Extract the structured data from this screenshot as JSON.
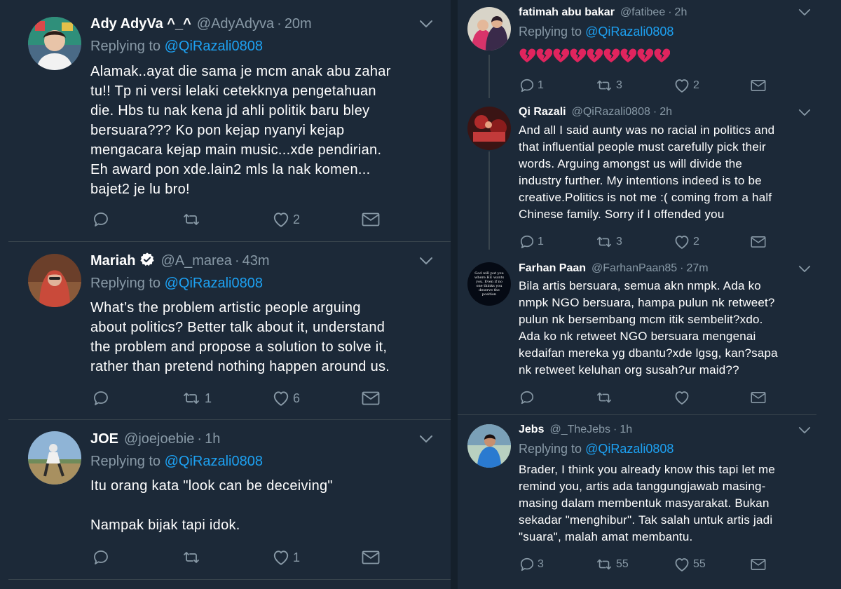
{
  "left": {
    "tweets": [
      {
        "name": "Ady AdyVa ^_^",
        "handle": "@AdyAdyva",
        "time": "20m",
        "replying_label": "Replying to",
        "mention": "@QiRazali0808",
        "body": "Alamak..ayat die sama je mcm anak abu zahar\ntu!! Tp ni versi lelaki cetekknya pengetahuan\ndie. Hbs tu nak kena jd ahli politik baru bley\nbersuara??? Ko pon kejap nyanyi kejap\nmengacara kejap main music...xde pendirian.\nEh award pon xde.lain2 mls la nak komen...\nbajet2 je lu bro!",
        "replies": "",
        "retweets": "",
        "likes": "2"
      },
      {
        "name": "Mariah",
        "handle": "@A_marea",
        "time": "43m",
        "replying_label": "Replying to",
        "mention": "@QiRazali0808",
        "body": "What’s the problem artistic people arguing\nabout politics? Better talk about it, understand\nthe problem and propose a solution to solve it,\nrather than pretend nothing happen around us.",
        "replies": "",
        "retweets": "1",
        "likes": "6"
      },
      {
        "name": "JOE",
        "handle": "@joejoebie",
        "time": "1h",
        "replying_label": "Replying to",
        "mention": "@QiRazali0808",
        "body": "Itu orang kata \"look can be deceiving\"\n\nNampak bijak tapi idok.",
        "replies": "",
        "retweets": "",
        "likes": "1"
      }
    ]
  },
  "right": {
    "tweets": [
      {
        "name": "fatimah abu bakar",
        "handle": "@fatibee",
        "time": "2h",
        "replying_label": "Replying to",
        "mention": "@QiRazali0808",
        "body": "",
        "emoji": "💔💔💔💔💔💔💔💔💔",
        "replies": "1",
        "retweets": "3",
        "likes": "2"
      },
      {
        "name": "Qi Razali",
        "handle": "@QiRazali0808",
        "time": "2h",
        "body": "And all I said aunty was no racial in politics and\nthat influential people must carefully pick their\nwords. Arguing amongst us will divide the\nindustry further. My intentions indeed is to be\ncreative.Politics is not me :( coming from a half\nChinese family. Sorry if I offended you",
        "replies": "1",
        "retweets": "3",
        "likes": "2"
      },
      {
        "name": "Farhan Paan",
        "handle": "@FarhanPaan85",
        "time": "27m",
        "avatar_text": "God will put you where HE wants you. Even if no one thinks you deserve the position",
        "body": "Bila artis bersuara, semua akn nmpk. Ada ko\nnmpk NGO bersuara, hampa pulun nk retweet?\npulun nk bersembang mcm itik sembelit?xdo.\nAda ko nk retweet NGO bersuara mengenai\nkedaifan mereka yg dbantu?xde lgsg, kan?sapa\nnk retweet keluhan org susah?ur maid??",
        "replies": "",
        "retweets": "",
        "likes": ""
      },
      {
        "name": "Jebs",
        "handle": "@_TheJebs",
        "time": "1h",
        "replying_label": "Replying to",
        "mention": "@QiRazali0808",
        "body": "Brader, I think you already know this tapi let me\nremind you, artis ada tanggungjawab masing-\nmasing dalam membentuk masyarakat. Bukan\nsekadar \"menghibur\". Tak salah untuk artis jadi\n\"suara\", malah amat membantu.",
        "replies": "3",
        "retweets": "55",
        "likes": "55"
      }
    ]
  },
  "colors": {
    "background": "#1c2938",
    "text": "#ffffff",
    "muted": "#8899a6",
    "link": "#1da1f2",
    "divider": "#38444d",
    "broken_heart": "#e0245e"
  },
  "icons": {
    "reply": "reply-icon",
    "retweet": "retweet-icon",
    "like": "heart-icon",
    "message": "envelope-icon",
    "caret": "chevron-down-icon",
    "verified": "verified-badge-icon"
  }
}
